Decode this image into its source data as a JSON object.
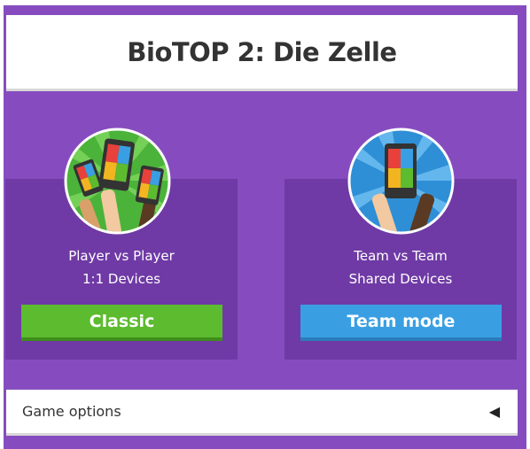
{
  "title": "BioTOP 2: Die Zelle",
  "modes": [
    {
      "line1": "Player vs Player",
      "line2": "1:1 Devices",
      "button": "Classic",
      "color": "#5dbb2f",
      "icon": "player-vs-player-illustration"
    },
    {
      "line1": "Team vs Team",
      "line2": "Shared Devices",
      "button": "Team mode",
      "color": "#3a9fe2",
      "icon": "team-vs-team-illustration"
    }
  ],
  "options": {
    "label": "Game options",
    "arrow": "◀"
  },
  "colors": {
    "background": "#864cbf",
    "card": "#6f3aa5"
  }
}
